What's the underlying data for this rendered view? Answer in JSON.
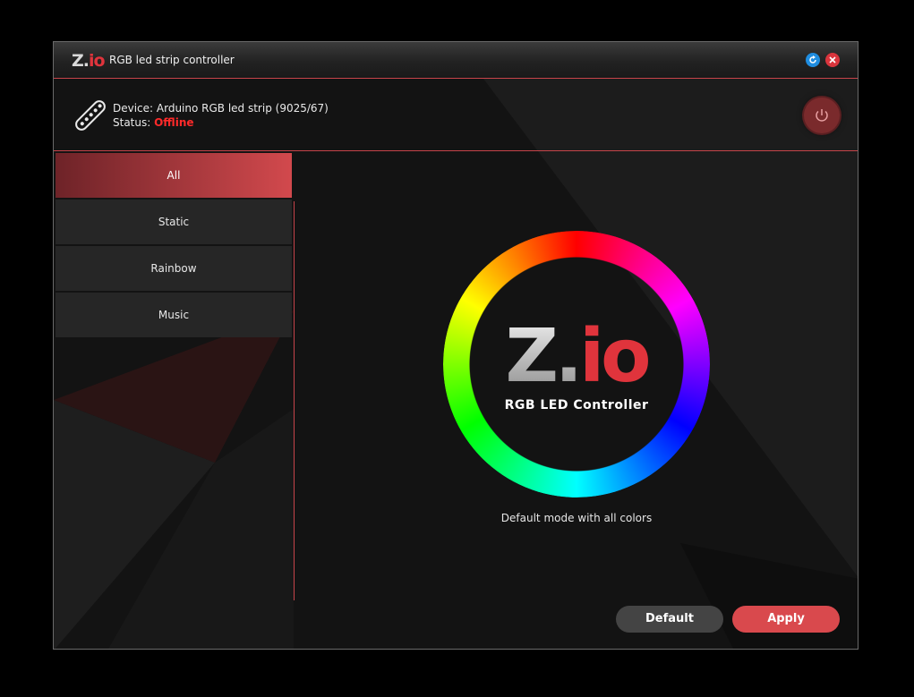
{
  "titlebar": {
    "logo_z": "Z.",
    "logo_io": "io",
    "title": "RGB led strip controller",
    "refresh_icon": "refresh-icon",
    "close_icon": "close-icon"
  },
  "device": {
    "label": "Device: Arduino RGB led strip (9025/67)",
    "status_label": "Status: ",
    "status_value": "Offline",
    "status_color": "#ff2a2a",
    "power_icon": "power-icon"
  },
  "sidebar": {
    "items": [
      {
        "label": "All",
        "active": true
      },
      {
        "label": "Static",
        "active": false
      },
      {
        "label": "Rainbow",
        "active": false
      },
      {
        "label": "Music",
        "active": false
      }
    ]
  },
  "main": {
    "logo_z": "Z.",
    "logo_io": "io",
    "logo_subtitle": "RGB LED Controller",
    "description": "Default mode with all colors"
  },
  "actions": {
    "default_label": "Default",
    "apply_label": "Apply"
  },
  "colors": {
    "accent": "#d9494d",
    "border_accent": "#c7444a",
    "refresh": "#1f8de0",
    "close": "#d9353d"
  }
}
